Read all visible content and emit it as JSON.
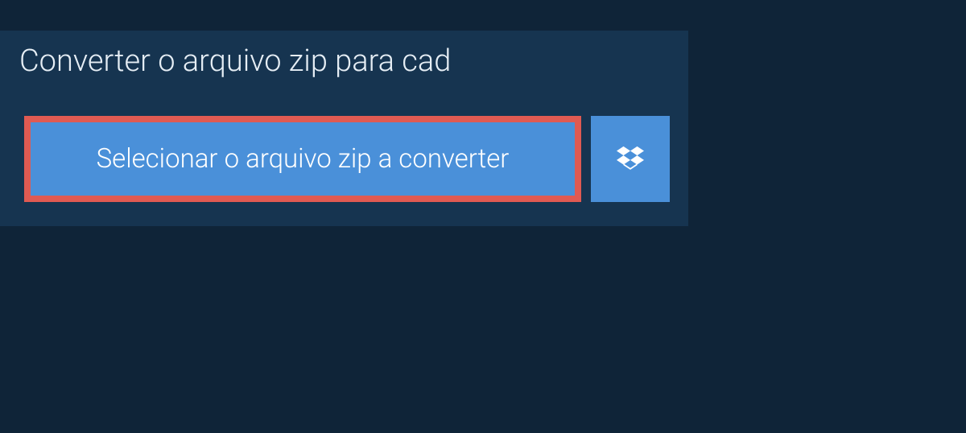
{
  "header": {
    "title": "Converter o arquivo zip para cad"
  },
  "actions": {
    "select_file_label": "Selecionar o arquivo zip a converter"
  },
  "icons": {
    "dropbox": "dropbox-icon"
  },
  "colors": {
    "page_bg": "#0f2438",
    "panel_bg": "#163450",
    "button_bg": "#4a90d9",
    "highlight_border": "#e05a52",
    "text": "#ffffff"
  }
}
